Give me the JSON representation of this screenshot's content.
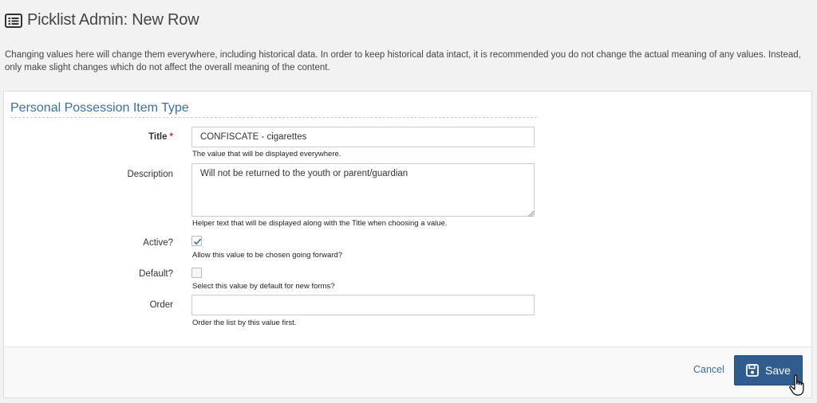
{
  "header": {
    "icon": "list-icon",
    "title": "Picklist Admin: New Row"
  },
  "warning_text": "Changing values here will change them everywhere, including historical data. In order to keep historical data intact, it is recommended you do not change the actual meaning of any values. Instead, only make slight changes which do not affect the overall meaning of the content.",
  "form": {
    "legend": "Personal Possession Item Type",
    "title": {
      "label": "Title",
      "required_mark": "*",
      "value": "CONFISCATE - cigarettes",
      "help": "The value that will be displayed everywhere."
    },
    "description": {
      "label": "Description",
      "value": "Will not be returned to the youth or parent/guardian",
      "help": "Helper text that will be displayed along with the Title when choosing a value."
    },
    "active": {
      "label": "Active?",
      "checked": true,
      "help": "Allow this value to be chosen going forward?"
    },
    "default": {
      "label": "Default?",
      "checked": false,
      "help": "Select this value by default for new forms?"
    },
    "order": {
      "label": "Order",
      "value": "",
      "help": "Order the list by this value first."
    }
  },
  "actions": {
    "cancel_label": "Cancel",
    "save_label": "Save",
    "save_icon": "floppy-disk-icon"
  },
  "colors": {
    "accent": "#305d8e",
    "link": "#3a6fa0",
    "required": "#c9302c"
  }
}
